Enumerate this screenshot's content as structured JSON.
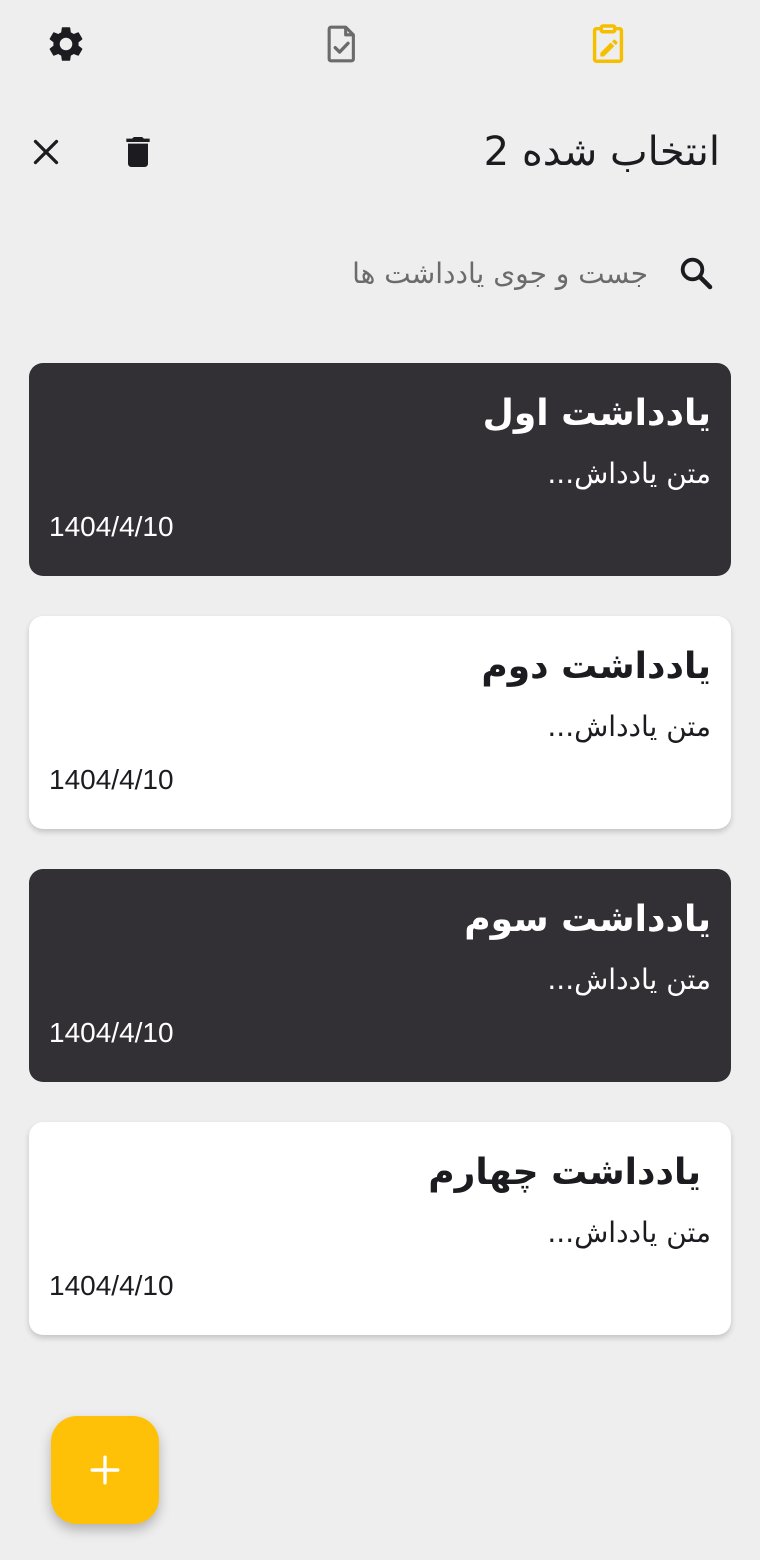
{
  "colors": {
    "background": "#eeeeee",
    "accent": "#ffc107",
    "active_tab": "#f5bf00",
    "inactive_tab": "#6b6b6b",
    "selected_card": "#322f35",
    "card": "#ffffff"
  },
  "topbar": {
    "settings_icon": "gear-icon",
    "tasks_icon": "task-check-icon",
    "notes_icon": "edit-note-icon",
    "active_tab": "notes"
  },
  "selection": {
    "title": "انتخاب شده 2",
    "selected_count": 2,
    "close_icon": "close-icon",
    "delete_icon": "trash-icon"
  },
  "search": {
    "placeholder": "جست و جوی یادداشت ها",
    "value": "",
    "icon": "search-icon"
  },
  "notes": [
    {
      "title": "یادداشت اول",
      "body": "متن یادداش...",
      "date": "1404/4/10",
      "selected": true
    },
    {
      "title": "یادداشت دوم",
      "body": "متن یادداش...",
      "date": "1404/4/10",
      "selected": false
    },
    {
      "title": "یادداشت سوم",
      "body": "متن یادداش...",
      "date": "1404/4/10",
      "selected": true
    },
    {
      "title": "یادداشت چهارم",
      "body": "متن یادداش...",
      "date": "1404/4/10",
      "selected": false
    }
  ],
  "fab": {
    "icon": "plus-icon"
  }
}
